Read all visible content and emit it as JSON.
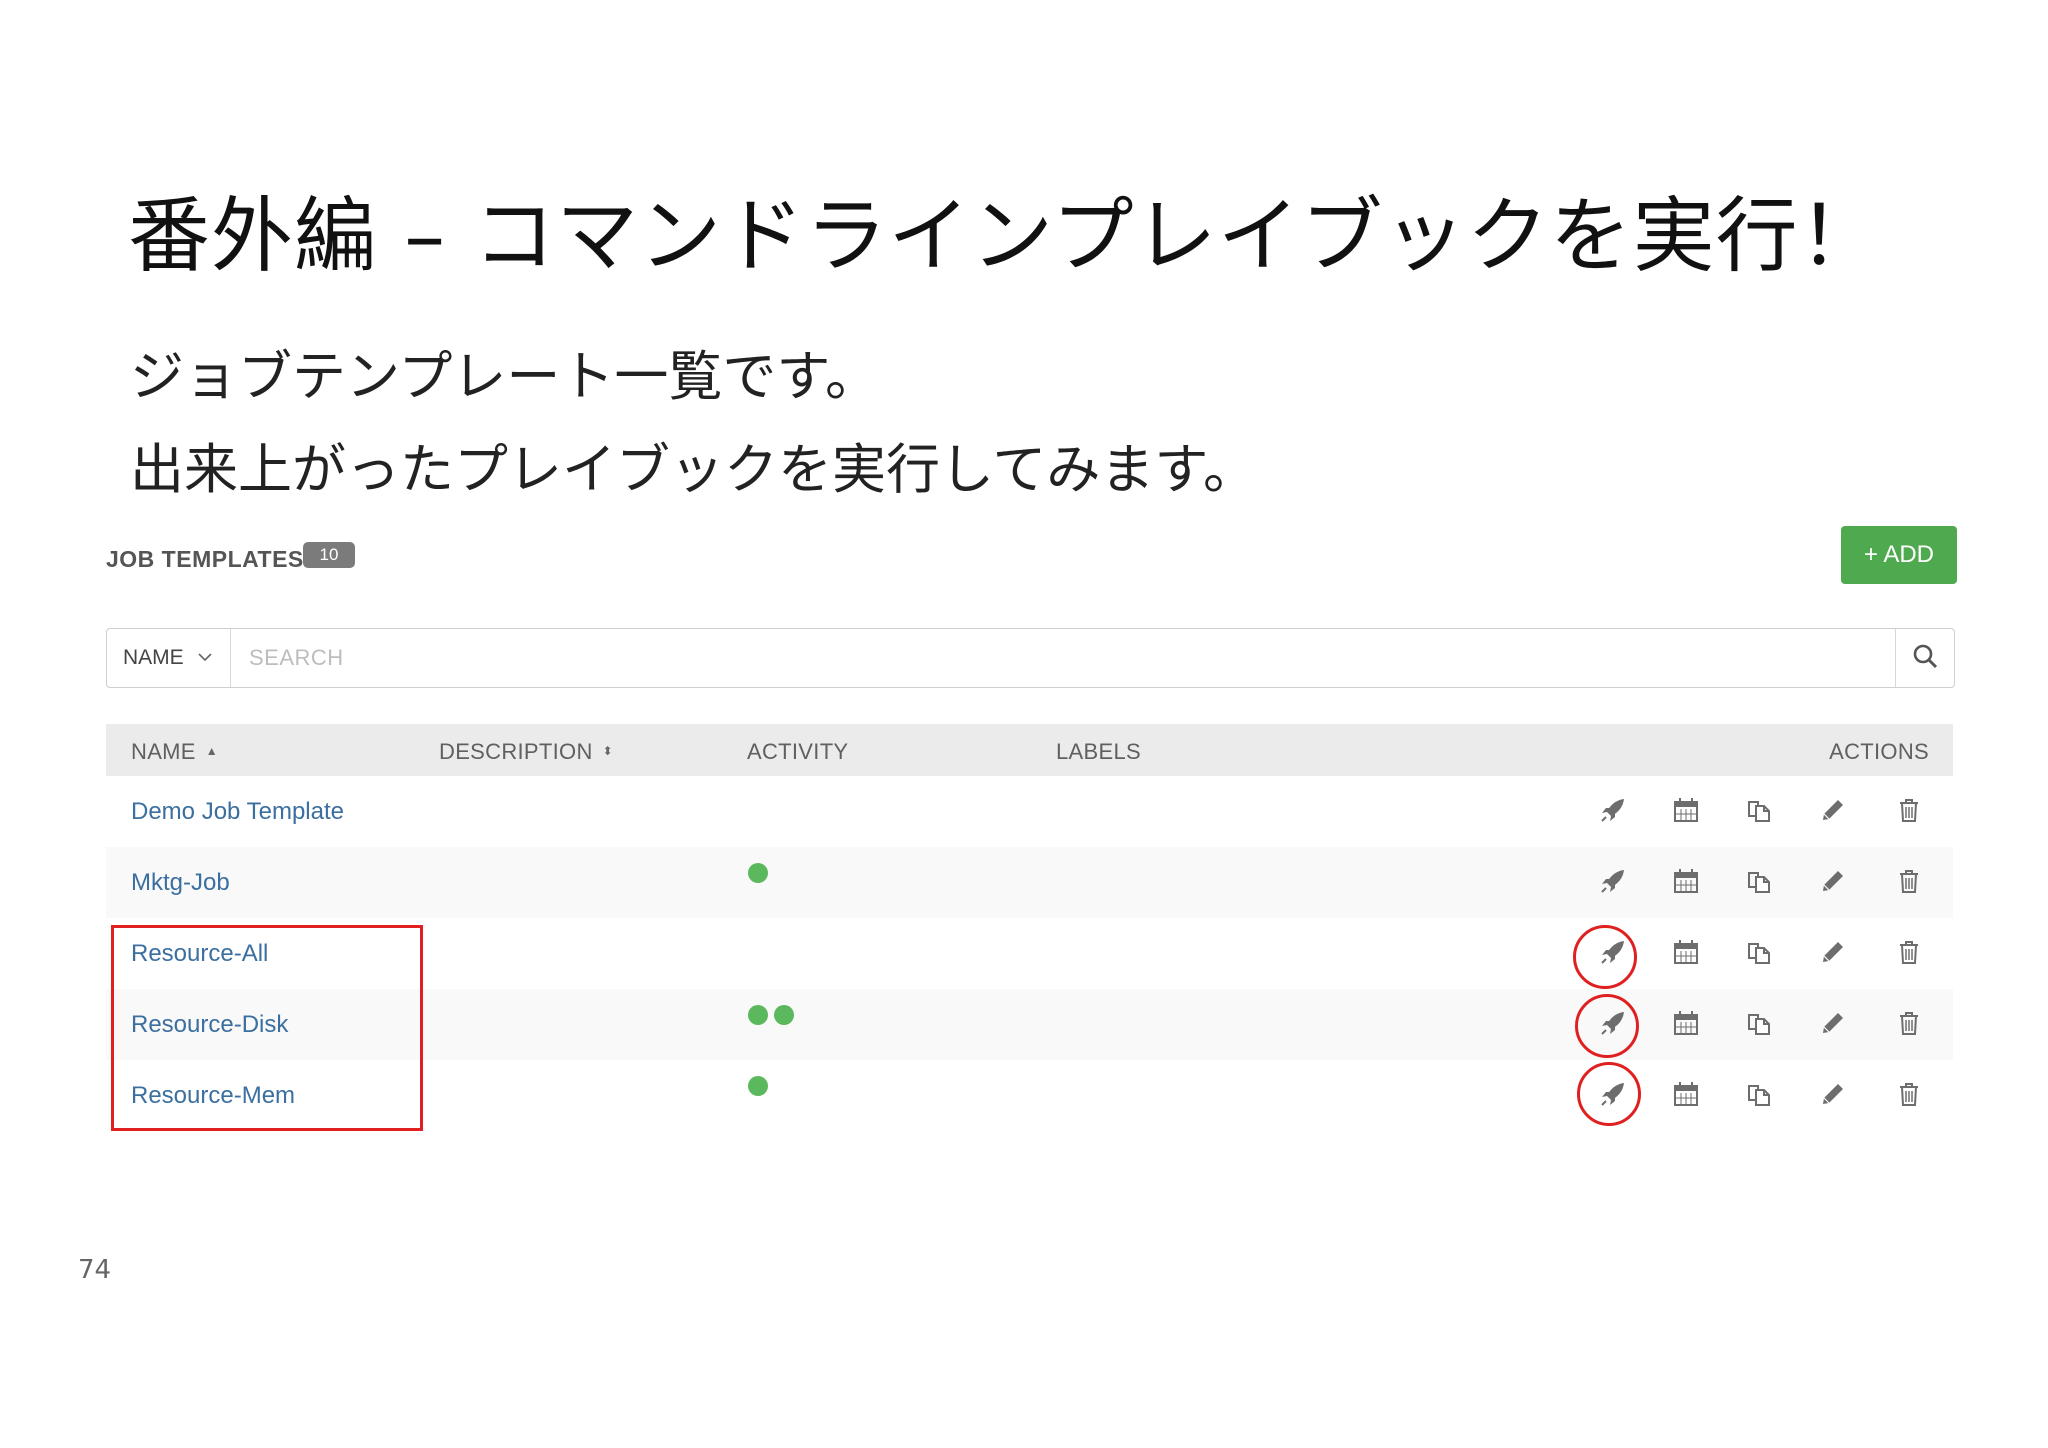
{
  "slide": {
    "title": "番外編 – コマンドラインプレイブックを実行！",
    "subtitle_line1": "ジョブテンプレート一覧です。",
    "subtitle_line2": "出来上がったプレイブックを実行してみます。",
    "page_number": "74"
  },
  "panel": {
    "title": "JOB TEMPLATES",
    "count": "10",
    "add_label": "+ ADD"
  },
  "search": {
    "key_label": "NAME",
    "placeholder": "SEARCH",
    "icon": "search-icon"
  },
  "table": {
    "columns": [
      "NAME",
      "DESCRIPTION",
      "ACTIVITY",
      "LABELS",
      "ACTIONS"
    ],
    "rows": [
      {
        "name": "Demo Job Template",
        "activity_dots": 0
      },
      {
        "name": "Mktg-Job",
        "activity_dots": 1
      },
      {
        "name": "Resource-All",
        "activity_dots": 0
      },
      {
        "name": "Resource-Disk",
        "activity_dots": 2
      },
      {
        "name": "Resource-Mem",
        "activity_dots": 1
      }
    ],
    "row_actions": [
      "launch-rocket-icon",
      "schedule-calendar-icon",
      "copy-icon",
      "edit-pencil-icon",
      "delete-trash-icon"
    ],
    "status_color": "#5cb85c",
    "link_color": "#3b6fa0"
  },
  "annotation": {
    "highlight_color": "#e02020",
    "highlighted_rows": [
      "Resource-All",
      "Resource-Disk",
      "Resource-Mem"
    ]
  }
}
